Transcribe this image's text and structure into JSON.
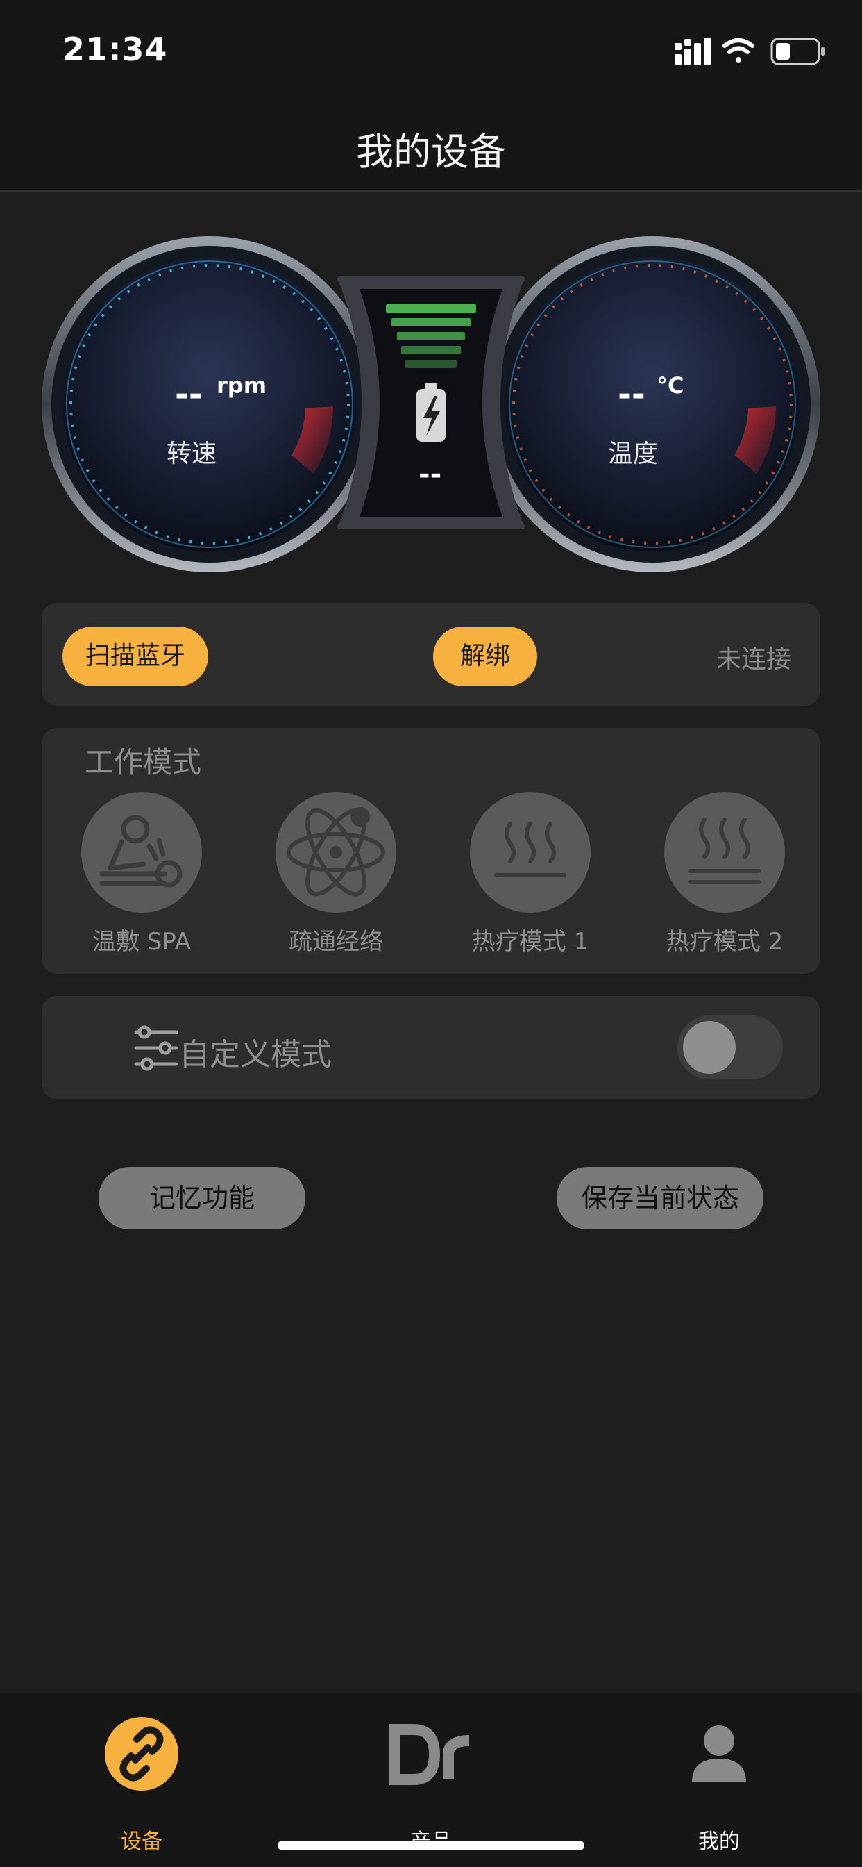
{
  "status_bar": {
    "time": "21:34"
  },
  "nav": {
    "title": "我的设备"
  },
  "gauges": {
    "speed": {
      "value": "--",
      "unit": "rpm",
      "label": "转速"
    },
    "battery": {
      "value": "--"
    },
    "temperature": {
      "value": "--",
      "unit": "°C",
      "label": "温度"
    }
  },
  "connection": {
    "scan_label": "扫描蓝牙",
    "unbind_label": "解绑",
    "status": "未连接"
  },
  "work_mode": {
    "title": "工作模式",
    "modes": [
      {
        "label": "温敷 SPA",
        "icon": "massage-icon"
      },
      {
        "label": "疏通经络",
        "icon": "atom-icon"
      },
      {
        "label": "热疗模式 1",
        "icon": "heat-icon"
      },
      {
        "label": "热疗模式 2",
        "icon": "heat-double-icon"
      }
    ]
  },
  "custom_mode": {
    "label": "自定义模式",
    "enabled": false
  },
  "actions": {
    "memory_label": "记忆功能",
    "save_label": "保存当前状态"
  },
  "tabbar": {
    "items": [
      {
        "label": "设备",
        "icon": "link-icon",
        "active": true
      },
      {
        "label": "产品",
        "icon": "dr-logo-icon",
        "active": false
      },
      {
        "label": "我的",
        "icon": "user-icon",
        "active": false
      }
    ]
  },
  "colors": {
    "accent": "#f6b13f",
    "background": "#1e1e1e",
    "card": "#2d2d2d"
  }
}
